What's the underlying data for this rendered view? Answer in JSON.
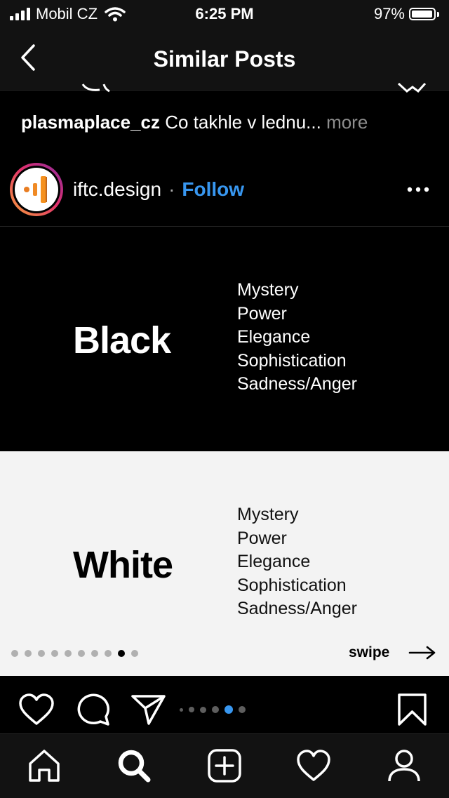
{
  "status_bar": {
    "carrier": "Mobil CZ",
    "time": "6:25 PM",
    "battery_percent": "97%",
    "battery_level": 0.97,
    "signal_bars": 4,
    "icons": [
      "signal-icon",
      "wifi-icon",
      "battery-icon"
    ]
  },
  "nav": {
    "title": "Similar Posts",
    "back_icon": "chevron-left-icon"
  },
  "previous_post": {
    "username": "plasmaplace_cz",
    "caption": "Co takhle v lednu...",
    "more_label": "more"
  },
  "post": {
    "username": "iftc.design",
    "separator": "·",
    "follow_label": "Follow",
    "options_icon": "more-horizontal-icon",
    "slides": [
      {
        "word": "Black",
        "attributes": [
          "Mystery",
          "Power",
          "Elegance",
          "Sophistication",
          "Sadness/Anger"
        ],
        "background": "#000000",
        "text_color": "#ffffff"
      },
      {
        "word": "White",
        "attributes": [
          "Mystery",
          "Power",
          "Elegance",
          "Sophistication",
          "Sadness/Anger"
        ],
        "background": "#f3f3f3",
        "text_color": "#000000",
        "swipe_label": "swipe",
        "page_dots_total": 10,
        "page_dots_active_index": 8
      }
    ],
    "actions": {
      "icons": [
        "heart-icon",
        "comment-icon",
        "share-icon",
        "bookmark-icon"
      ],
      "carousel_dots_total": 6,
      "carousel_dots_active_index": 4
    }
  },
  "tab_bar": {
    "items": [
      "home-icon",
      "search-icon",
      "add-post-icon",
      "activity-icon",
      "profile-icon"
    ],
    "active": "search-icon"
  },
  "colors": {
    "accent": "#3897f0",
    "bar_background": "#121212",
    "secondary_text": "#8e8e8e"
  }
}
